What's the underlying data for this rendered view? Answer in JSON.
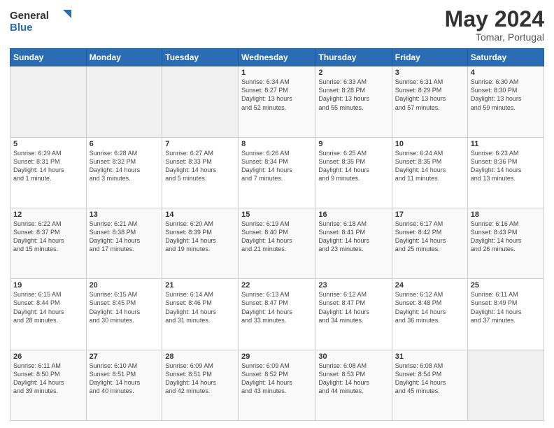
{
  "header": {
    "logo_line1": "General",
    "logo_line2": "Blue",
    "month": "May 2024",
    "location": "Tomar, Portugal"
  },
  "weekdays": [
    "Sunday",
    "Monday",
    "Tuesday",
    "Wednesday",
    "Thursday",
    "Friday",
    "Saturday"
  ],
  "weeks": [
    [
      {
        "day": "",
        "info": ""
      },
      {
        "day": "",
        "info": ""
      },
      {
        "day": "",
        "info": ""
      },
      {
        "day": "1",
        "info": "Sunrise: 6:34 AM\nSunset: 8:27 PM\nDaylight: 13 hours\nand 52 minutes."
      },
      {
        "day": "2",
        "info": "Sunrise: 6:33 AM\nSunset: 8:28 PM\nDaylight: 13 hours\nand 55 minutes."
      },
      {
        "day": "3",
        "info": "Sunrise: 6:31 AM\nSunset: 8:29 PM\nDaylight: 13 hours\nand 57 minutes."
      },
      {
        "day": "4",
        "info": "Sunrise: 6:30 AM\nSunset: 8:30 PM\nDaylight: 13 hours\nand 59 minutes."
      }
    ],
    [
      {
        "day": "5",
        "info": "Sunrise: 6:29 AM\nSunset: 8:31 PM\nDaylight: 14 hours\nand 1 minute."
      },
      {
        "day": "6",
        "info": "Sunrise: 6:28 AM\nSunset: 8:32 PM\nDaylight: 14 hours\nand 3 minutes."
      },
      {
        "day": "7",
        "info": "Sunrise: 6:27 AM\nSunset: 8:33 PM\nDaylight: 14 hours\nand 5 minutes."
      },
      {
        "day": "8",
        "info": "Sunrise: 6:26 AM\nSunset: 8:34 PM\nDaylight: 14 hours\nand 7 minutes."
      },
      {
        "day": "9",
        "info": "Sunrise: 6:25 AM\nSunset: 8:35 PM\nDaylight: 14 hours\nand 9 minutes."
      },
      {
        "day": "10",
        "info": "Sunrise: 6:24 AM\nSunset: 8:35 PM\nDaylight: 14 hours\nand 11 minutes."
      },
      {
        "day": "11",
        "info": "Sunrise: 6:23 AM\nSunset: 8:36 PM\nDaylight: 14 hours\nand 13 minutes."
      }
    ],
    [
      {
        "day": "12",
        "info": "Sunrise: 6:22 AM\nSunset: 8:37 PM\nDaylight: 14 hours\nand 15 minutes."
      },
      {
        "day": "13",
        "info": "Sunrise: 6:21 AM\nSunset: 8:38 PM\nDaylight: 14 hours\nand 17 minutes."
      },
      {
        "day": "14",
        "info": "Sunrise: 6:20 AM\nSunset: 8:39 PM\nDaylight: 14 hours\nand 19 minutes."
      },
      {
        "day": "15",
        "info": "Sunrise: 6:19 AM\nSunset: 8:40 PM\nDaylight: 14 hours\nand 21 minutes."
      },
      {
        "day": "16",
        "info": "Sunrise: 6:18 AM\nSunset: 8:41 PM\nDaylight: 14 hours\nand 23 minutes."
      },
      {
        "day": "17",
        "info": "Sunrise: 6:17 AM\nSunset: 8:42 PM\nDaylight: 14 hours\nand 25 minutes."
      },
      {
        "day": "18",
        "info": "Sunrise: 6:16 AM\nSunset: 8:43 PM\nDaylight: 14 hours\nand 26 minutes."
      }
    ],
    [
      {
        "day": "19",
        "info": "Sunrise: 6:15 AM\nSunset: 8:44 PM\nDaylight: 14 hours\nand 28 minutes."
      },
      {
        "day": "20",
        "info": "Sunrise: 6:15 AM\nSunset: 8:45 PM\nDaylight: 14 hours\nand 30 minutes."
      },
      {
        "day": "21",
        "info": "Sunrise: 6:14 AM\nSunset: 8:46 PM\nDaylight: 14 hours\nand 31 minutes."
      },
      {
        "day": "22",
        "info": "Sunrise: 6:13 AM\nSunset: 8:47 PM\nDaylight: 14 hours\nand 33 minutes."
      },
      {
        "day": "23",
        "info": "Sunrise: 6:12 AM\nSunset: 8:47 PM\nDaylight: 14 hours\nand 34 minutes."
      },
      {
        "day": "24",
        "info": "Sunrise: 6:12 AM\nSunset: 8:48 PM\nDaylight: 14 hours\nand 36 minutes."
      },
      {
        "day": "25",
        "info": "Sunrise: 6:11 AM\nSunset: 8:49 PM\nDaylight: 14 hours\nand 37 minutes."
      }
    ],
    [
      {
        "day": "26",
        "info": "Sunrise: 6:11 AM\nSunset: 8:50 PM\nDaylight: 14 hours\nand 39 minutes."
      },
      {
        "day": "27",
        "info": "Sunrise: 6:10 AM\nSunset: 8:51 PM\nDaylight: 14 hours\nand 40 minutes."
      },
      {
        "day": "28",
        "info": "Sunrise: 6:09 AM\nSunset: 8:51 PM\nDaylight: 14 hours\nand 42 minutes."
      },
      {
        "day": "29",
        "info": "Sunrise: 6:09 AM\nSunset: 8:52 PM\nDaylight: 14 hours\nand 43 minutes."
      },
      {
        "day": "30",
        "info": "Sunrise: 6:08 AM\nSunset: 8:53 PM\nDaylight: 14 hours\nand 44 minutes."
      },
      {
        "day": "31",
        "info": "Sunrise: 6:08 AM\nSunset: 8:54 PM\nDaylight: 14 hours\nand 45 minutes."
      },
      {
        "day": "",
        "info": ""
      }
    ]
  ]
}
